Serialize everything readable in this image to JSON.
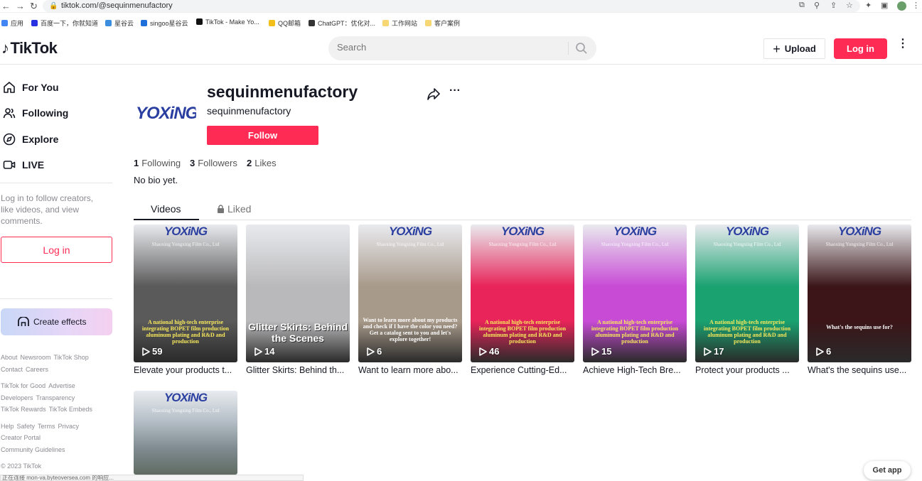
{
  "browser": {
    "url": "tiktok.com/@sequinmenufactory",
    "bookmarks": [
      {
        "label": "应用",
        "color": "#4285f4"
      },
      {
        "label": "百度一下，你就知道",
        "color": "#2932e1"
      },
      {
        "label": "星谷云",
        "color": "#3c8dde"
      },
      {
        "label": "singoo星谷云",
        "color": "#1e6fd9"
      },
      {
        "label": "TikTok - Make Yo...",
        "color": "#111111"
      },
      {
        "label": "QQ邮箱",
        "color": "#f3c01b"
      },
      {
        "label": "ChatGPT：优化对...",
        "color": "#333333"
      },
      {
        "label": "工作网站",
        "color": "#f7d774"
      },
      {
        "label": "客户案例",
        "color": "#f7d774"
      }
    ],
    "status_text": "正在连接 mon-va.byteoversea.com 的响应..."
  },
  "header": {
    "logo": "TikTok",
    "search_placeholder": "Search",
    "upload_label": "Upload",
    "login_label": "Log in"
  },
  "sidebar": {
    "nav": [
      {
        "label": "For You",
        "icon": "home-icon"
      },
      {
        "label": "Following",
        "icon": "people-icon"
      },
      {
        "label": "Explore",
        "icon": "compass-icon"
      },
      {
        "label": "LIVE",
        "icon": "live-icon"
      }
    ],
    "login_hint": "Log in to follow creators, like videos, and view comments.",
    "login_button": "Log in",
    "create_effects": "Create effects",
    "footer": {
      "row1": [
        "About",
        "Newsroom",
        "TikTok Shop"
      ],
      "row2": [
        "Contact",
        "Careers"
      ],
      "row3": [
        "TikTok for Good",
        "Advertise"
      ],
      "row4": [
        "Developers",
        "Transparency"
      ],
      "row5": [
        "TikTok Rewards",
        "TikTok Embeds"
      ],
      "row6": [
        "Help",
        "Safety",
        "Terms",
        "Privacy"
      ],
      "row7": [
        "Creator Portal"
      ],
      "row8": [
        "Community Guidelines"
      ],
      "copyright": "© 2023 TikTok"
    }
  },
  "profile": {
    "avatar_text": "YOXiNG",
    "title": "sequinmenufactory",
    "subtitle": "sequinmenufactory",
    "follow_label": "Follow",
    "stats": {
      "following_count": "1",
      "following_label": "Following",
      "followers_count": "3",
      "followers_label": "Followers",
      "likes_count": "2",
      "likes_label": "Likes"
    },
    "bio": "No bio yet."
  },
  "tabs": {
    "videos": "Videos",
    "liked": "Liked"
  },
  "videos": [
    {
      "views": "59",
      "caption": "Elevate your products t...",
      "logo": "YOXiNG",
      "company": "Shaoxing Yongxing Film Co., Ltd",
      "overlay": "A national high-tech enterprise integrating BOPET film production aluminum plating and R&D and production",
      "bg": "#5a5a5a"
    },
    {
      "views": "14",
      "caption": "Glitter Skirts: Behind th...",
      "logo": "",
      "company": "",
      "overlay": "Glitter Skirts: Behind the Scenes",
      "bg": "#b9b9bb"
    },
    {
      "views": "6",
      "caption": "Want to learn more abo...",
      "logo": "YOXiNG",
      "company": "Shaoxing Yongxing Film Co., Ltd",
      "overlay": "Want to learn more about my products and check if I have the color you need? Get a catalog sent to you and let's explore together!",
      "bg": "#a89a8a"
    },
    {
      "views": "46",
      "caption": "Experience Cutting-Ed...",
      "logo": "YOXiNG",
      "company": "Shaoxing Yongxing Film Co., Ltd",
      "overlay": "A national high-tech enterprise integrating BOPET film production aluminum plating and R&D and production",
      "bg": "#e8245a"
    },
    {
      "views": "15",
      "caption": "Achieve High-Tech Bre...",
      "logo": "YOXiNG",
      "company": "Shaoxing Yongxing Film Co., Ltd",
      "overlay": "A national high-tech enterprise integrating BOPET film production aluminum plating and R&D and production",
      "bg": "#c84bd6"
    },
    {
      "views": "17",
      "caption": "Protect your products ...",
      "logo": "YOXiNG",
      "company": "Shaoxing Yongxing Film Co., Ltd",
      "overlay": "A national high-tech enterprise integrating BOPET film production aluminum plating and R&D and production",
      "bg": "#1aa271"
    },
    {
      "views": "6",
      "caption": "What's the sequins use...",
      "logo": "YOXiNG",
      "company": "Shaoxing Yongxing Film Co., Ltd",
      "overlay": "What's the sequins use for?",
      "bg": "#3b1518"
    },
    {
      "views": "",
      "caption": "",
      "logo": "YOXiNG",
      "company": "Shaoxing Yongxing Film Co., Ltd",
      "overlay": "",
      "bg": "#8c97a3"
    }
  ],
  "get_app": "Get app"
}
